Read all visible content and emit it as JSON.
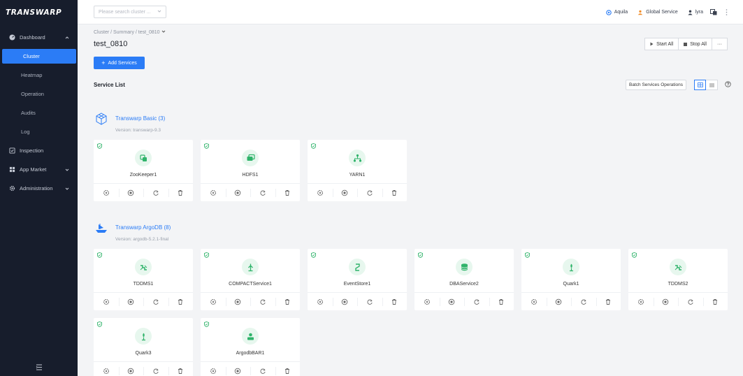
{
  "app": {
    "logo": "TRANSWARP"
  },
  "sidebar": {
    "items": [
      {
        "label": "Dashboard",
        "icon": "dashboard-icon",
        "expanded": true
      },
      {
        "label": "Cluster",
        "active": true
      },
      {
        "label": "Heatmap"
      },
      {
        "label": "Operation"
      },
      {
        "label": "Audits"
      },
      {
        "label": "Log"
      },
      {
        "label": "Inspection",
        "icon": "inspection-icon"
      },
      {
        "label": "App Market",
        "icon": "grid-icon"
      },
      {
        "label": "Administration",
        "icon": "gear-icon"
      }
    ],
    "collapse_icon": "menu-collapse-icon"
  },
  "topbar": {
    "search_placeholder": "Please search cluster ...",
    "aquila": "Aquila",
    "global_service": "Global Service",
    "user": "lyra",
    "colors": {
      "aquila": "#2b7cf6",
      "global": "#f08a24"
    }
  },
  "main": {
    "breadcrumb": "Cluster / Summary / test_0810",
    "title": "test_0810",
    "add_services": "Add Services",
    "start_all": "Start All",
    "stop_all": "Stop All",
    "more": "···",
    "service_list": "Service List",
    "batch_ops": "Batch Services Operations"
  },
  "groups": [
    {
      "title": "Transwarp Basic (3)",
      "version": "Version: transwarp-9.3",
      "services": [
        {
          "name": "ZooKeeper1",
          "icon": "zookeeper-icon"
        },
        {
          "name": "HDFS1",
          "icon": "hdfs-icon"
        },
        {
          "name": "YARN1",
          "icon": "yarn-icon"
        }
      ]
    },
    {
      "title": "Transwarp ArgoDB (8)",
      "version": "Version: argodb-5.2.1-final",
      "services": [
        {
          "name": "TDDMS1",
          "icon": "tddms-icon"
        },
        {
          "name": "COMPACTService1",
          "icon": "compact-icon"
        },
        {
          "name": "EventStore1",
          "icon": "eventstore-icon"
        },
        {
          "name": "DBAService2",
          "icon": "database-icon"
        },
        {
          "name": "Quark1",
          "icon": "quark-icon"
        },
        {
          "name": "TDDMS2",
          "icon": "tddms-icon"
        },
        {
          "name": "Quark3",
          "icon": "quark-icon"
        },
        {
          "name": "ArgodbBAR1",
          "icon": "argodb-bar-icon"
        }
      ]
    }
  ],
  "colors": {
    "accent": "#2b7cf6",
    "service_green": "#2fb36a",
    "sidebar_bg": "#171d2c"
  }
}
